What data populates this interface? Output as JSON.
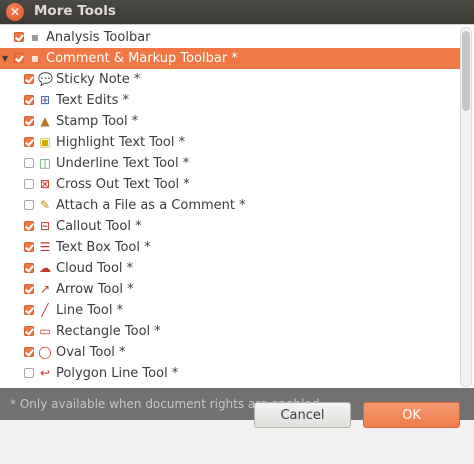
{
  "window": {
    "title": "More Tools"
  },
  "tree": {
    "items": [
      {
        "label": "Analysis Toolbar",
        "checked": true,
        "icon": "toolbar-icon",
        "level": 0
      },
      {
        "label": "Comment & Markup Toolbar *",
        "checked": true,
        "icon": "toolbar-icon",
        "level": 0,
        "expanded": true,
        "selected": true
      },
      {
        "label": "Sticky Note *",
        "checked": true,
        "icon": "sticky-note-icon",
        "level": 1
      },
      {
        "label": "Text Edits *",
        "checked": true,
        "icon": "text-edits-icon",
        "level": 1
      },
      {
        "label": "Stamp Tool *",
        "checked": true,
        "icon": "stamp-icon",
        "level": 1
      },
      {
        "label": "Highlight Text Tool *",
        "checked": true,
        "icon": "highlight-icon",
        "level": 1
      },
      {
        "label": "Underline Text Tool *",
        "checked": false,
        "icon": "underline-icon",
        "level": 1
      },
      {
        "label": "Cross Out Text Tool *",
        "checked": false,
        "icon": "cross-out-icon",
        "level": 1
      },
      {
        "label": "Attach a File as a Comment *",
        "checked": false,
        "icon": "attach-file-icon",
        "level": 1
      },
      {
        "label": "Callout Tool *",
        "checked": true,
        "icon": "callout-icon",
        "level": 1
      },
      {
        "label": "Text Box Tool *",
        "checked": true,
        "icon": "text-box-icon",
        "level": 1
      },
      {
        "label": "Cloud Tool *",
        "checked": true,
        "icon": "cloud-icon",
        "level": 1
      },
      {
        "label": "Arrow Tool *",
        "checked": true,
        "icon": "arrow-icon",
        "level": 1
      },
      {
        "label": "Line Tool *",
        "checked": true,
        "icon": "line-icon",
        "level": 1
      },
      {
        "label": "Rectangle Tool *",
        "checked": true,
        "icon": "rectangle-icon",
        "level": 1
      },
      {
        "label": "Oval Tool *",
        "checked": true,
        "icon": "oval-icon",
        "level": 1
      },
      {
        "label": "Polygon Line Tool *",
        "checked": false,
        "icon": "polygon-line-icon",
        "level": 1
      }
    ]
  },
  "footnote": "* Only available when document rights are enabled.",
  "buttons": {
    "cancel": "Cancel",
    "ok": "OK"
  },
  "colors": {
    "accent": "#f07746",
    "titlebar": "#3c3b37"
  }
}
